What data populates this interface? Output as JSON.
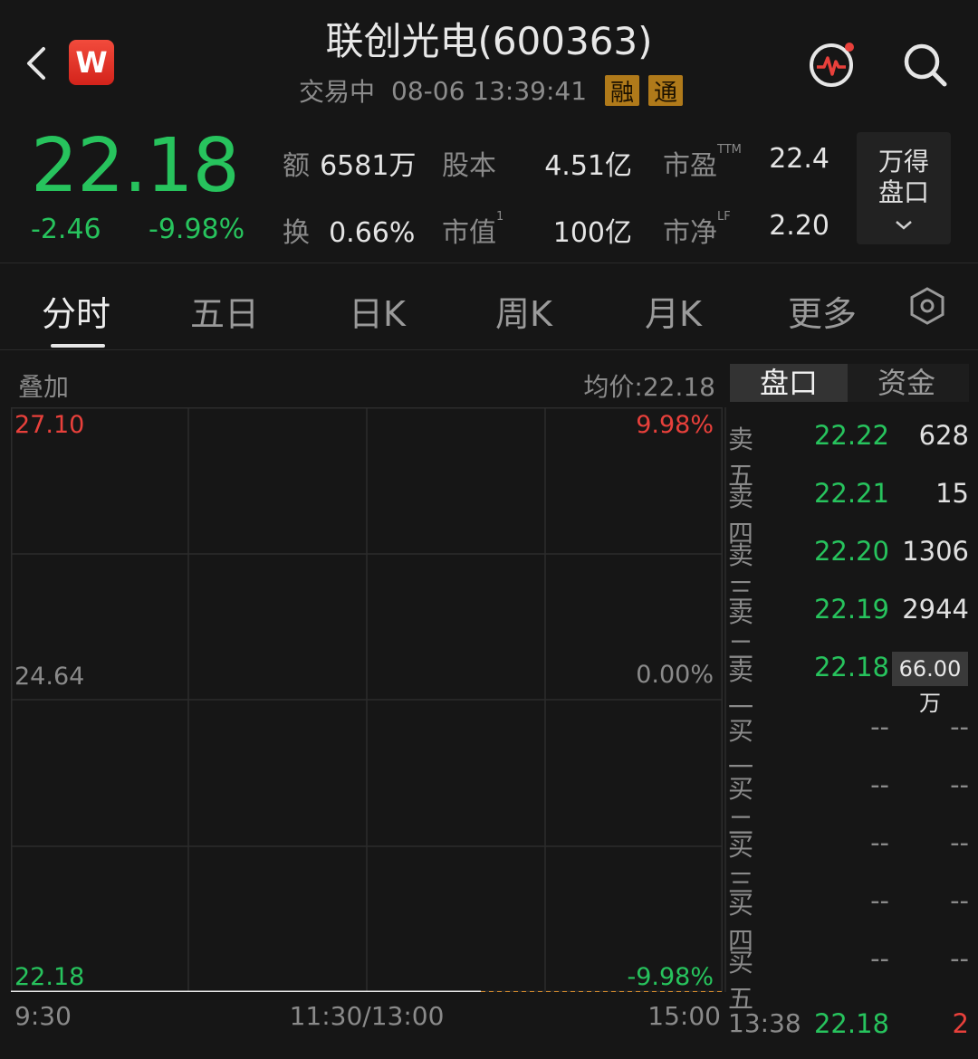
{
  "header": {
    "title": "联创光电(600363)",
    "status": "交易中",
    "datetime": "08-06 13:39:41",
    "tags": [
      "融",
      "通"
    ],
    "logo_letter": "W"
  },
  "quote": {
    "price": "22.18",
    "change": "-2.46",
    "change_pct": "-9.98%",
    "stats": [
      {
        "label": "额",
        "sup": "",
        "value": "6581万"
      },
      {
        "label": "股本",
        "sup": "",
        "value": "4.51亿"
      },
      {
        "label": "市盈",
        "sup": "TTM",
        "value": "22.4"
      },
      {
        "label": "换",
        "sup": "",
        "value": "0.66%"
      },
      {
        "label": "市值",
        "sup": "1",
        "value": "100亿"
      },
      {
        "label": "市净",
        "sup": "LF",
        "value": "2.20"
      }
    ],
    "wind_button": {
      "line1": "万得",
      "line2": "盘口"
    }
  },
  "tabs": [
    "分时",
    "五日",
    "日K",
    "周K",
    "月K",
    "更多"
  ],
  "chart": {
    "overlay_label": "叠加",
    "avg_price": "均价:22.18",
    "left_top": "27.10",
    "left_mid": "24.64",
    "left_bottom": "22.18",
    "right_top": "9.98%",
    "right_mid": "0.00%",
    "right_bottom": "-9.98%",
    "x_start": "9:30",
    "x_mid": "11:30/13:00",
    "x_end": "15:00",
    "elapsed_fraction": 0.66,
    "colors": {
      "up": "#e8403b",
      "down": "#27c35d",
      "neutral": "#8a8a8a",
      "future_line": "#d38a2c"
    }
  },
  "orderbook": {
    "tabs": [
      "盘口",
      "资金"
    ],
    "asks": [
      {
        "label": "卖五",
        "price": "22.22",
        "volume": "628"
      },
      {
        "label": "卖四",
        "price": "22.21",
        "volume": "15"
      },
      {
        "label": "卖三",
        "price": "22.20",
        "volume": "1306"
      },
      {
        "label": "卖二",
        "price": "22.19",
        "volume": "2944"
      },
      {
        "label": "卖一",
        "price": "22.18",
        "volume": "66.00万"
      }
    ],
    "bids": [
      {
        "label": "买一",
        "price": "--",
        "volume": "--"
      },
      {
        "label": "买二",
        "price": "--",
        "volume": "--"
      },
      {
        "label": "买三",
        "price": "--",
        "volume": "--"
      },
      {
        "label": "买四",
        "price": "--",
        "volume": "--"
      },
      {
        "label": "买五",
        "price": "--",
        "volume": "--"
      }
    ],
    "last_trade": {
      "time": "13:38",
      "price": "22.18",
      "volume": "2"
    }
  }
}
